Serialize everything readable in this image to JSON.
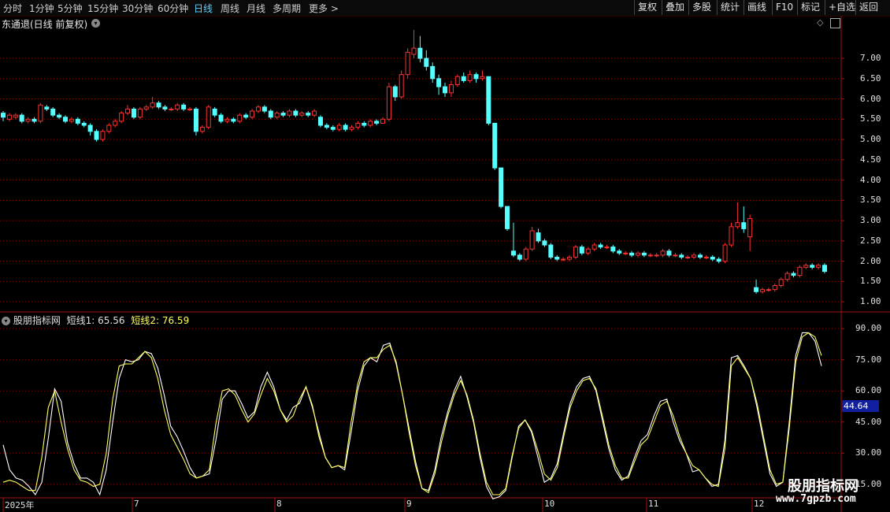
{
  "timeframes": [
    "分时",
    "1分钟",
    "5分钟",
    "15分钟",
    "30分钟",
    "60分钟",
    "日线",
    "周线",
    "月线",
    "多周期",
    "更多 >"
  ],
  "active_timeframe": "日线",
  "toolbar_buttons": [
    "复权",
    "叠加",
    "多股",
    "统计",
    "画线",
    "F10",
    "标记",
    "+自选",
    "返回"
  ],
  "stock_title": "东通退(日线 前复权)",
  "price_axis": [
    "7.00",
    "6.50",
    "6.00",
    "5.50",
    "5.00",
    "4.50",
    "4.00",
    "3.50",
    "3.00",
    "2.50",
    "2.00",
    "1.50",
    "1.00"
  ],
  "indicator": {
    "name": "股朋指标网",
    "line1_label": "短线1: 65.56",
    "line2_label": "短线2: 76.59",
    "axis": [
      "90.00",
      "75.00",
      "60.00",
      "45.00",
      "30.00",
      "15.00"
    ],
    "current_value": "44.64"
  },
  "time_axis": [
    {
      "label": "2025年"
    },
    {
      "label": "7"
    },
    {
      "label": "8"
    },
    {
      "label": "9"
    },
    {
      "label": "10"
    },
    {
      "label": "11"
    },
    {
      "label": "12"
    }
  ],
  "watermark": {
    "title": "股朋指标网",
    "url": "www.7gpzb.com"
  },
  "colors": {
    "up": "#ff3030",
    "down": "#54ffff",
    "line1": "#ffff60",
    "line2": "#ffffff",
    "grid": "#8a0000",
    "border": "#a01010"
  },
  "chart_data": [
    {
      "type": "candlestick",
      "title": "东通退(日线 前复权)",
      "ylim": [
        1.0,
        7.5
      ],
      "candles": [
        [
          5.65,
          5.55,
          5.7,
          5.45
        ],
        [
          5.5,
          5.6,
          5.65,
          5.45
        ],
        [
          5.55,
          5.6,
          5.65,
          5.5
        ],
        [
          5.6,
          5.45,
          5.65,
          5.4
        ],
        [
          5.45,
          5.5,
          5.55,
          5.4
        ],
        [
          5.5,
          5.45,
          5.55,
          5.4
        ],
        [
          5.45,
          5.85,
          5.9,
          5.4
        ],
        [
          5.8,
          5.75,
          5.85,
          5.7
        ],
        [
          5.75,
          5.6,
          5.8,
          5.55
        ],
        [
          5.6,
          5.55,
          5.65,
          5.5
        ],
        [
          5.55,
          5.45,
          5.6,
          5.4
        ],
        [
          5.45,
          5.5,
          5.55,
          5.4
        ],
        [
          5.5,
          5.4,
          5.55,
          5.35
        ],
        [
          5.4,
          5.35,
          5.45,
          5.3
        ],
        [
          5.35,
          5.2,
          5.4,
          5.1
        ],
        [
          5.2,
          5.0,
          5.25,
          4.95
        ],
        [
          5.0,
          5.2,
          5.25,
          4.95
        ],
        [
          5.2,
          5.35,
          5.4,
          5.15
        ],
        [
          5.35,
          5.45,
          5.5,
          5.3
        ],
        [
          5.45,
          5.65,
          5.7,
          5.4
        ],
        [
          5.65,
          5.75,
          5.85,
          5.6
        ],
        [
          5.75,
          5.55,
          5.8,
          5.5
        ],
        [
          5.55,
          5.75,
          5.8,
          5.5
        ],
        [
          5.75,
          5.8,
          5.85,
          5.7
        ],
        [
          5.8,
          5.9,
          6.05,
          5.75
        ],
        [
          5.9,
          5.8,
          5.95,
          5.75
        ],
        [
          5.8,
          5.75,
          5.85,
          5.7
        ],
        [
          5.75,
          5.75,
          5.8,
          5.7
        ],
        [
          5.75,
          5.85,
          5.9,
          5.7
        ],
        [
          5.85,
          5.75,
          5.9,
          5.7
        ],
        [
          5.75,
          5.75,
          5.8,
          5.7
        ],
        [
          5.75,
          5.2,
          5.8,
          5.1
        ],
        [
          5.2,
          5.3,
          5.35,
          5.15
        ],
        [
          5.3,
          5.8,
          5.85,
          5.25
        ],
        [
          5.75,
          5.6,
          5.8,
          5.55
        ],
        [
          5.6,
          5.45,
          5.65,
          5.4
        ],
        [
          5.45,
          5.5,
          5.55,
          5.4
        ],
        [
          5.5,
          5.45,
          5.55,
          5.4
        ],
        [
          5.45,
          5.6,
          5.65,
          5.4
        ],
        [
          5.6,
          5.55,
          5.65,
          5.5
        ],
        [
          5.55,
          5.7,
          5.75,
          5.5
        ],
        [
          5.7,
          5.8,
          5.85,
          5.65
        ],
        [
          5.8,
          5.7,
          5.85,
          5.65
        ],
        [
          5.7,
          5.55,
          5.75,
          5.5
        ],
        [
          5.55,
          5.65,
          5.7,
          5.5
        ],
        [
          5.65,
          5.6,
          5.7,
          5.55
        ],
        [
          5.6,
          5.7,
          5.75,
          5.55
        ],
        [
          5.7,
          5.6,
          5.75,
          5.55
        ],
        [
          5.6,
          5.65,
          5.7,
          5.55
        ],
        [
          5.65,
          5.6,
          5.7,
          5.55
        ],
        [
          5.6,
          5.7,
          5.75,
          5.55
        ],
        [
          5.55,
          5.35,
          5.6,
          5.3
        ],
        [
          5.35,
          5.3,
          5.4,
          5.25
        ],
        [
          5.3,
          5.25,
          5.35,
          5.2
        ],
        [
          5.25,
          5.35,
          5.4,
          5.2
        ],
        [
          5.35,
          5.25,
          5.4,
          5.2
        ],
        [
          5.25,
          5.3,
          5.35,
          5.2
        ],
        [
          5.3,
          5.4,
          5.45,
          5.25
        ],
        [
          5.4,
          5.35,
          5.45,
          5.3
        ],
        [
          5.35,
          5.45,
          5.5,
          5.3
        ],
        [
          5.45,
          5.4,
          5.5,
          5.35
        ],
        [
          5.4,
          5.5,
          5.55,
          5.4
        ],
        [
          5.5,
          6.3,
          6.4,
          5.45
        ],
        [
          6.3,
          6.05,
          6.35,
          5.95
        ],
        [
          6.05,
          6.6,
          6.7,
          6.0
        ],
        [
          6.6,
          7.15,
          7.25,
          6.5
        ],
        [
          7.1,
          7.25,
          7.7,
          7.0
        ],
        [
          7.25,
          7.0,
          7.55,
          6.9
        ],
        [
          7.0,
          6.8,
          7.2,
          6.7
        ],
        [
          6.8,
          6.5,
          6.9,
          6.4
        ],
        [
          6.5,
          6.3,
          6.6,
          6.1
        ],
        [
          6.3,
          6.15,
          6.4,
          6.05
        ],
        [
          6.15,
          6.35,
          6.45,
          6.05
        ],
        [
          6.35,
          6.55,
          6.6,
          6.3
        ],
        [
          6.55,
          6.45,
          6.65,
          6.4
        ],
        [
          6.45,
          6.6,
          6.7,
          6.4
        ],
        [
          6.6,
          6.5,
          6.65,
          6.4
        ],
        [
          6.5,
          6.55,
          6.7,
          6.45
        ],
        [
          6.55,
          5.4,
          5.45,
          5.35
        ],
        [
          5.4,
          4.3,
          4.35,
          4.25
        ],
        [
          4.3,
          3.35,
          3.4,
          3.3
        ],
        [
          3.35,
          2.8,
          2.85,
          2.75
        ],
        [
          2.25,
          2.15,
          2.95,
          2.1
        ],
        [
          2.15,
          2.05,
          2.2,
          2.0
        ],
        [
          2.05,
          2.3,
          2.35,
          2.0
        ],
        [
          2.3,
          2.75,
          2.85,
          2.25
        ],
        [
          2.7,
          2.5,
          2.8,
          2.45
        ],
        [
          2.5,
          2.4,
          2.55,
          2.35
        ],
        [
          2.4,
          2.1,
          2.45,
          2.05
        ],
        [
          2.1,
          2.05,
          2.15,
          2.0
        ],
        [
          2.05,
          2.05,
          2.1,
          2.0
        ],
        [
          2.05,
          2.1,
          2.15,
          2.0
        ],
        [
          2.1,
          2.35,
          2.4,
          2.05
        ],
        [
          2.35,
          2.2,
          2.4,
          2.15
        ],
        [
          2.2,
          2.3,
          2.35,
          2.15
        ],
        [
          2.3,
          2.4,
          2.45,
          2.25
        ],
        [
          2.4,
          2.35,
          2.45,
          2.3
        ],
        [
          2.35,
          2.35,
          2.4,
          2.3
        ],
        [
          2.35,
          2.25,
          2.4,
          2.2
        ],
        [
          2.25,
          2.2,
          2.3,
          2.15
        ],
        [
          2.2,
          2.2,
          2.25,
          2.15
        ],
        [
          2.2,
          2.15,
          2.25,
          2.1
        ],
        [
          2.15,
          2.2,
          2.25,
          2.1
        ],
        [
          2.2,
          2.15,
          2.25,
          2.1
        ],
        [
          2.15,
          2.15,
          2.2,
          2.1
        ],
        [
          2.15,
          2.15,
          2.2,
          2.1
        ],
        [
          2.15,
          2.25,
          2.3,
          2.1
        ],
        [
          2.25,
          2.15,
          2.3,
          2.1
        ],
        [
          2.15,
          2.15,
          2.2,
          2.1
        ],
        [
          2.15,
          2.1,
          2.2,
          2.05
        ],
        [
          2.1,
          2.1,
          2.15,
          2.05
        ],
        [
          2.1,
          2.15,
          2.2,
          2.05
        ],
        [
          2.15,
          2.1,
          2.2,
          2.05
        ],
        [
          2.1,
          2.1,
          2.15,
          2.05
        ],
        [
          2.1,
          2.05,
          2.15,
          2.0
        ],
        [
          2.05,
          2.0,
          2.1,
          1.95
        ],
        [
          2.0,
          2.4,
          2.45,
          1.95
        ],
        [
          2.4,
          2.85,
          2.95,
          2.35
        ],
        [
          2.85,
          2.95,
          3.45,
          2.8
        ],
        [
          2.95,
          2.8,
          3.35,
          2.7
        ],
        [
          2.6,
          3.05,
          3.15,
          2.25
        ],
        [
          1.35,
          1.25,
          1.55,
          1.2
        ],
        [
          1.25,
          1.3,
          1.35,
          1.2
        ],
        [
          1.3,
          1.3,
          1.35,
          1.25
        ],
        [
          1.3,
          1.4,
          1.45,
          1.25
        ],
        [
          1.4,
          1.55,
          1.6,
          1.35
        ],
        [
          1.55,
          1.7,
          1.75,
          1.5
        ],
        [
          1.7,
          1.65,
          1.75,
          1.6
        ],
        [
          1.65,
          1.85,
          1.9,
          1.6
        ],
        [
          1.85,
          1.9,
          1.95,
          1.8
        ],
        [
          1.9,
          1.85,
          1.95,
          1.8
        ],
        [
          1.85,
          1.9,
          1.95,
          1.8
        ],
        [
          1.9,
          1.75,
          1.95,
          1.7
        ]
      ]
    },
    {
      "type": "line",
      "title": "股朋指标网",
      "ylim": [
        10,
        95
      ],
      "series": [
        {
          "name": "短线1",
          "values": [
            34,
            22,
            18,
            17,
            14,
            10,
            16,
            37,
            61,
            55,
            35,
            25,
            18,
            18,
            16,
            10,
            22,
            45,
            66,
            75,
            74,
            75,
            79,
            78,
            71,
            58,
            43,
            38,
            31,
            23,
            18,
            19,
            20,
            36,
            56,
            60,
            60,
            54,
            47,
            50,
            62,
            69,
            62,
            51,
            46,
            52,
            54,
            62,
            52,
            40,
            28,
            23,
            24,
            22,
            40,
            60,
            72,
            76,
            74,
            82,
            83,
            73,
            58,
            42,
            26,
            13,
            12,
            22,
            38,
            50,
            60,
            67,
            57,
            45,
            28,
            14,
            8,
            9,
            12,
            28,
            43,
            46,
            40,
            28,
            16,
            18,
            25,
            40,
            54,
            62,
            66,
            67,
            60,
            46,
            32,
            22,
            17,
            19,
            28,
            36,
            39,
            48,
            55,
            56,
            45,
            36,
            30,
            21,
            22,
            18,
            14,
            15,
            36,
            76,
            77,
            72,
            66,
            52,
            36,
            20,
            14,
            16,
            45,
            77,
            88,
            88,
            84,
            72
          ]
        },
        {
          "name": "短线2",
          "values": [
            16,
            17,
            16,
            14,
            12,
            12,
            28,
            52,
            60,
            45,
            32,
            22,
            17,
            16,
            14,
            15,
            30,
            56,
            72,
            73,
            73,
            76,
            79,
            76,
            66,
            51,
            39,
            33,
            27,
            20,
            18,
            19,
            22,
            44,
            60,
            61,
            58,
            51,
            45,
            49,
            58,
            66,
            60,
            51,
            45,
            48,
            56,
            62,
            53,
            38,
            28,
            23,
            24,
            23,
            45,
            63,
            74,
            76,
            76,
            80,
            82,
            74,
            58,
            40,
            24,
            13,
            11,
            20,
            35,
            48,
            58,
            65,
            58,
            46,
            30,
            16,
            10,
            10,
            13,
            29,
            42,
            46,
            41,
            31,
            20,
            17,
            23,
            38,
            52,
            60,
            65,
            66,
            61,
            48,
            34,
            24,
            18,
            18,
            26,
            34,
            37,
            45,
            53,
            55,
            48,
            38,
            30,
            24,
            22,
            18,
            15,
            14,
            32,
            72,
            76,
            71,
            66,
            54,
            38,
            22,
            15,
            16,
            42,
            74,
            86,
            88,
            86,
            77
          ]
        }
      ]
    }
  ]
}
